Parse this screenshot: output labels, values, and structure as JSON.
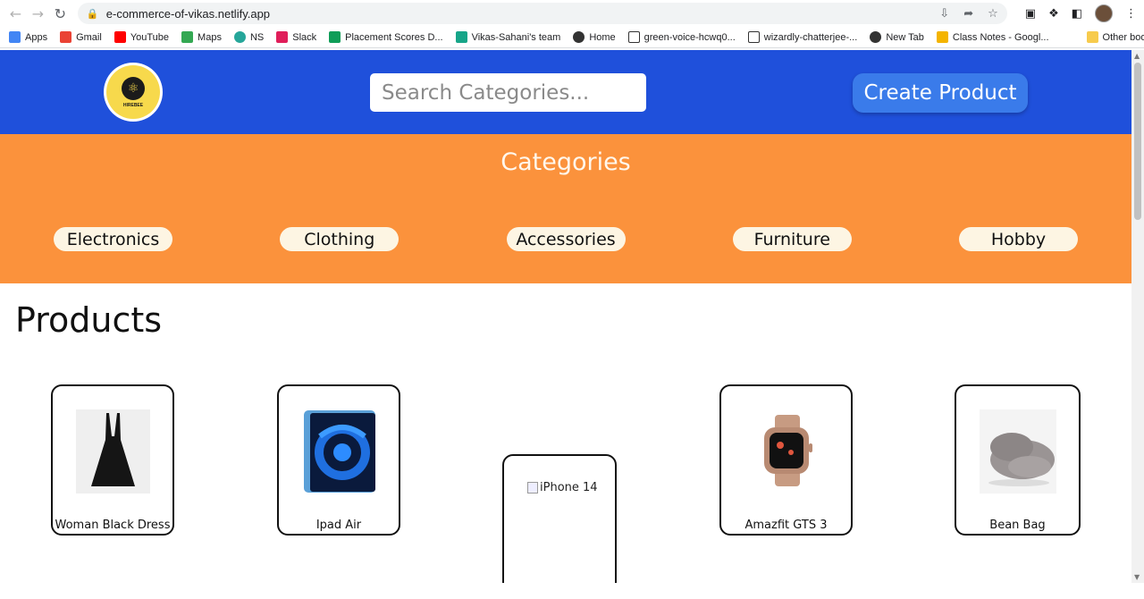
{
  "browser": {
    "url": "e-commerce-of-vikas.netlify.app",
    "bookmarks": [
      {
        "label": "Apps",
        "icon": "apps-grid-icon",
        "color": "#4285f4"
      },
      {
        "label": "Gmail",
        "icon": "gmail-icon",
        "color": "#ea4335"
      },
      {
        "label": "YouTube",
        "icon": "youtube-icon",
        "color": "#ff0000"
      },
      {
        "label": "Maps",
        "icon": "maps-icon",
        "color": "#34a853"
      },
      {
        "label": "NS",
        "icon": "ns-icon",
        "color": "#26a69a"
      },
      {
        "label": "Slack",
        "icon": "slack-icon",
        "color": "#e01e5a"
      },
      {
        "label": "Placement Scores D...",
        "icon": "sheets-icon",
        "color": "#0f9d58"
      },
      {
        "label": "Vikas-Sahani's team",
        "icon": "diamond-icon",
        "color": "#17a589"
      },
      {
        "label": "Home",
        "icon": "globe-icon",
        "color": "#333333"
      },
      {
        "label": "green-voice-hcwq0...",
        "icon": "page-icon",
        "color": "#ffffff"
      },
      {
        "label": "wizardly-chatterjee-...",
        "icon": "page-icon",
        "color": "#ffffff"
      },
      {
        "label": "New Tab",
        "icon": "globe-icon",
        "color": "#333333"
      },
      {
        "label": "Class Notes - Googl...",
        "icon": "slides-icon",
        "color": "#f4b400"
      }
    ],
    "other_bookmarks": "Other bookmarks"
  },
  "header": {
    "logo_text": "HIREBEE",
    "search_placeholder": "Search Categories...",
    "create_button": "Create Product"
  },
  "categories": {
    "title": "Categories",
    "items": [
      "Electronics",
      "Clothing",
      "Accessories",
      "Furniture",
      "Hobby"
    ]
  },
  "products": {
    "title": "Products",
    "items": [
      {
        "name": "Woman Black Dress",
        "image": "dress"
      },
      {
        "name": "Ipad Air",
        "image": "ipad"
      },
      {
        "name": "",
        "alt": "iPhone 14",
        "image": "broken"
      },
      {
        "name": "Amazfit GTS 3",
        "image": "watch"
      },
      {
        "name": "Bean Bag",
        "image": "beanbag"
      }
    ]
  },
  "colors": {
    "header_bg": "#1f50db",
    "category_bg": "#fb923c",
    "button_bg": "#3a7bea"
  }
}
